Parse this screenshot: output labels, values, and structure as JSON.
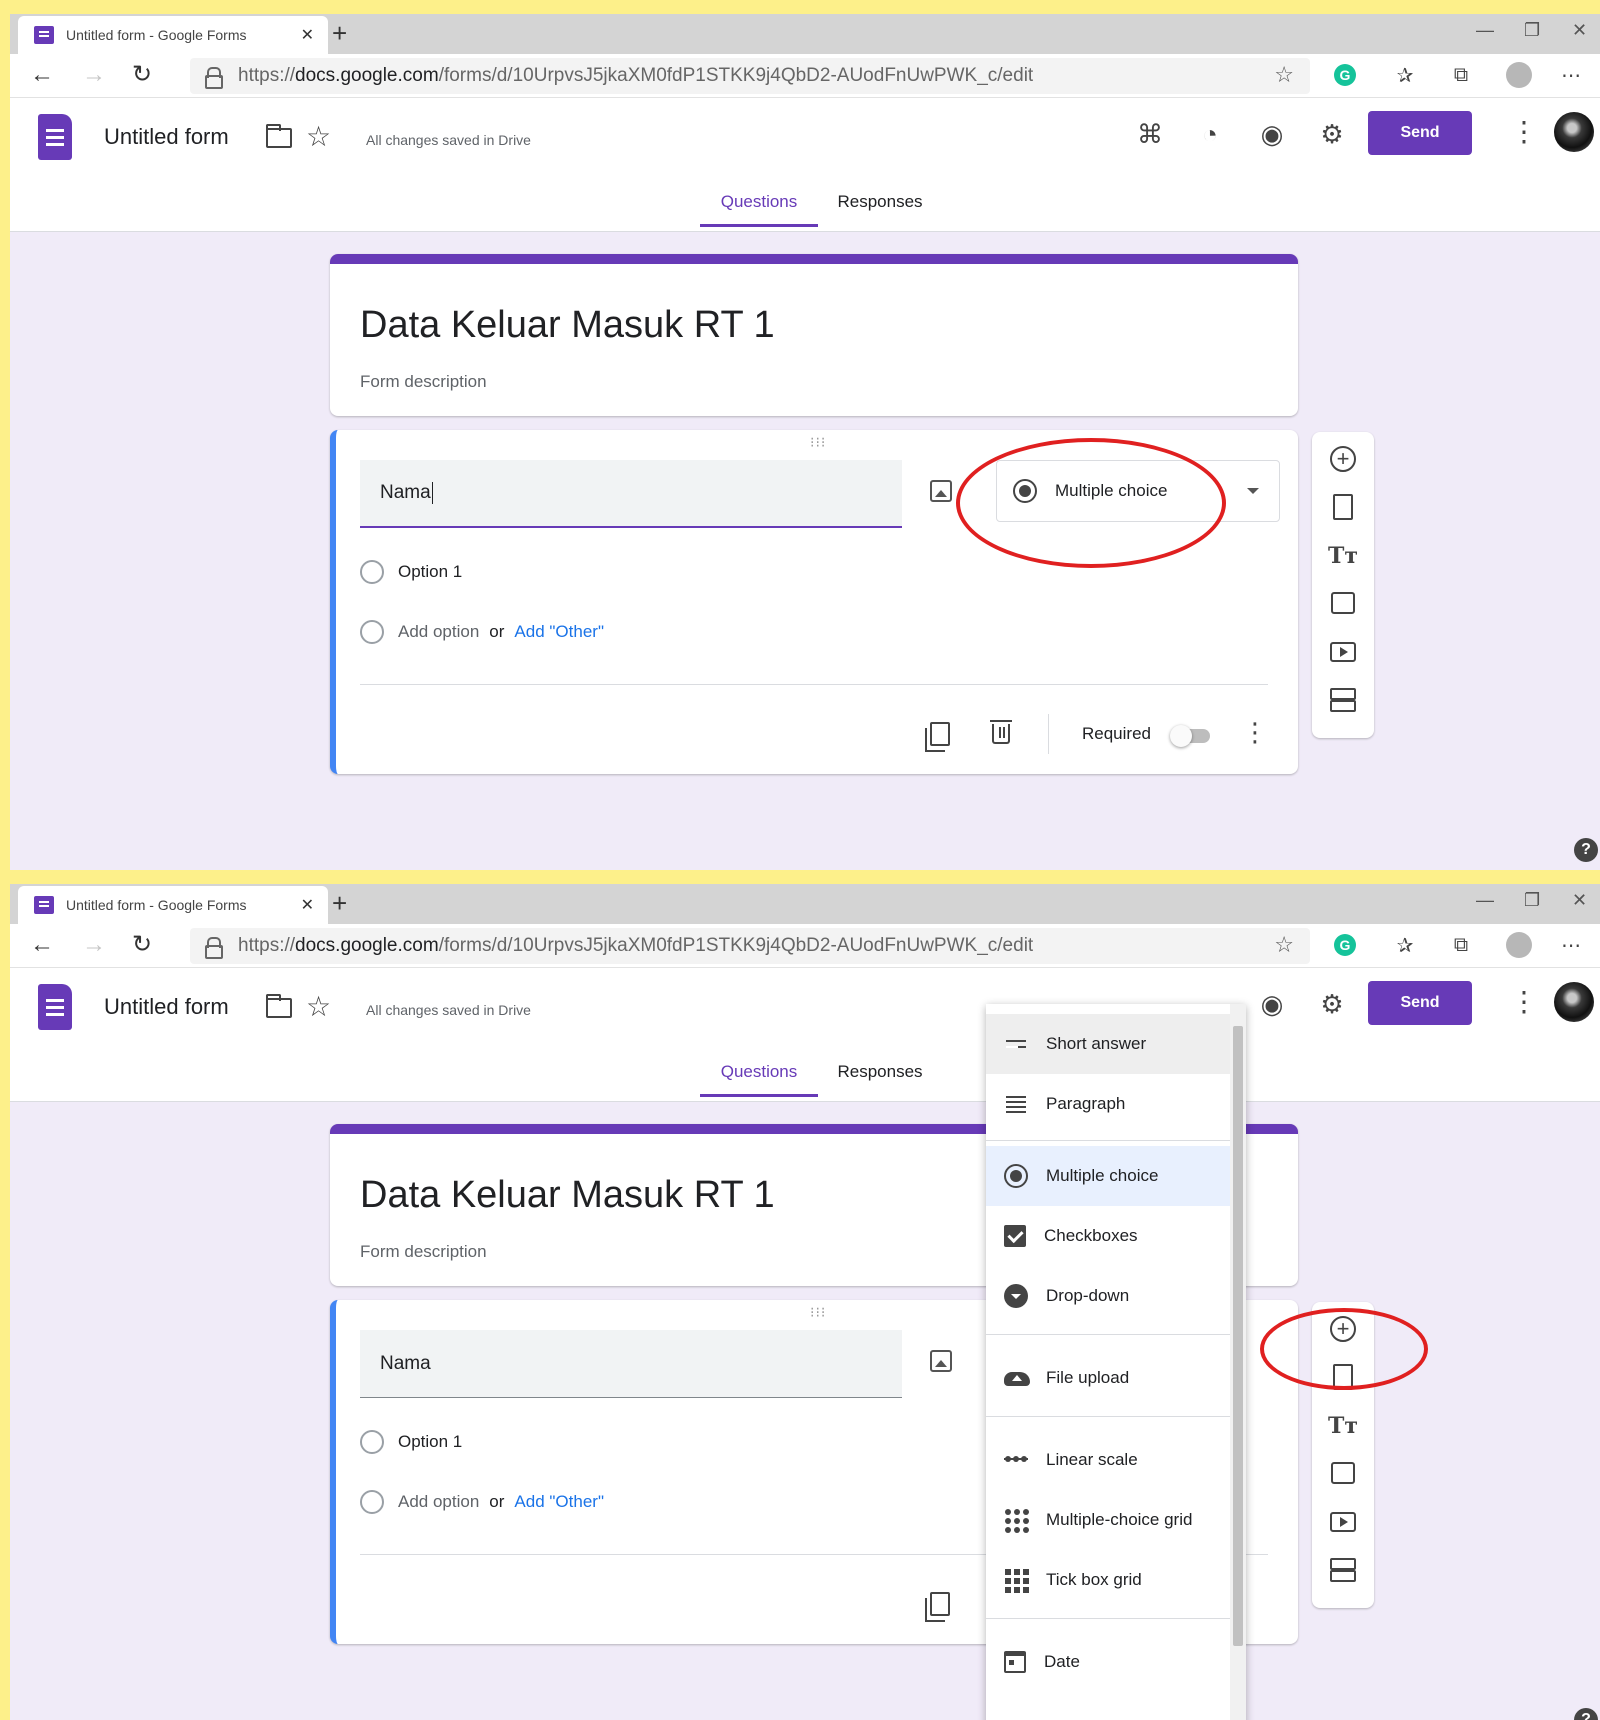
{
  "browser": {
    "tab_title": "Untitled form - Google Forms",
    "url_prefix": "https://",
    "url_domain": "docs.google.com",
    "url_path": "/forms/d/10UrpvsJ5jkaXM0fdP1STKK9j4QbD2-AUodFnUwPWK_c/edit"
  },
  "header": {
    "form_name": "Untitled form",
    "saved_status": "All changes saved in Drive",
    "send_label": "Send"
  },
  "tabs": {
    "questions": "Questions",
    "responses": "Responses"
  },
  "form": {
    "title": "Data Keluar Masuk RT 1",
    "description_placeholder": "Form description"
  },
  "question": {
    "title": "Nama",
    "type_selected": "Multiple choice",
    "option_1": "Option 1",
    "add_option": "Add option",
    "or": "or",
    "add_other": "Add \"Other\"",
    "required_label": "Required",
    "required_on": false
  },
  "type_menu": {
    "items": [
      {
        "label": "Short answer",
        "icon": "short-answer-icon"
      },
      {
        "label": "Paragraph",
        "icon": "paragraph-icon"
      },
      {
        "label": "Multiple choice",
        "icon": "radio-icon"
      },
      {
        "label": "Checkboxes",
        "icon": "checkbox-icon"
      },
      {
        "label": "Drop-down",
        "icon": "dropdown-icon"
      },
      {
        "label": "File upload",
        "icon": "cloud-upload-icon"
      },
      {
        "label": "Linear scale",
        "icon": "linear-scale-icon"
      },
      {
        "label": "Multiple-choice grid",
        "icon": "grid-dots-icon"
      },
      {
        "label": "Tick box grid",
        "icon": "grid-squares-icon"
      },
      {
        "label": "Date",
        "icon": "calendar-icon"
      }
    ]
  },
  "colors": {
    "brand": "#673ab7",
    "active_card": "#4285f4",
    "highlight_circle": "#e02020",
    "page_background": "#f0ebf8",
    "border_frame": "#fdf08a"
  }
}
